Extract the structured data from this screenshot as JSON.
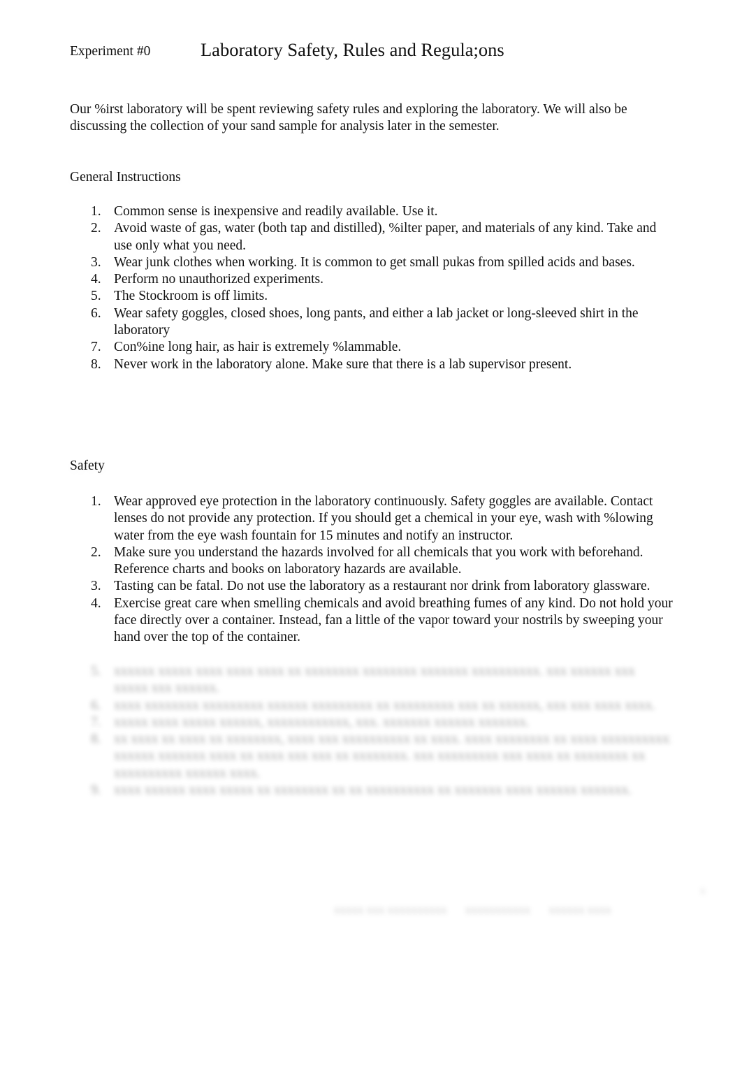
{
  "header": {
    "experiment_label": "Experiment #0",
    "title": "Laboratory Safety, Rules and Regula;ons"
  },
  "intro": "Our %irst laboratory will be spent reviewing safety rules and exploring the laboratory. We will also be discussing the collection of your sand sample for analysis later in the semester.",
  "general": {
    "heading": "General Instructions",
    "items": [
      {
        "num": "1.",
        "text": "Common sense is inexpensive and readily available. Use it."
      },
      {
        "num": "2.",
        "text": "Avoid waste of gas, water (both tap and distilled), %ilter paper, and materials of any kind. Take and use only what you need."
      },
      {
        "num": "3.",
        "text": "Wear junk clothes when working. It is common to get small pukas from spilled acids and bases."
      },
      {
        "num": "4.",
        "text": "Perform no unauthorized experiments."
      },
      {
        "num": "5.",
        "text": "The Stockroom is off limits."
      },
      {
        "num": "6.",
        "text": "Wear safety goggles, closed shoes, long pants, and either a lab jacket or long-sleeved shirt in the laboratory"
      },
      {
        "num": "7.",
        "text": "Con%ine long hair, as hair is extremely %lammable."
      },
      {
        "num": "8.",
        "text": "Never work in the laboratory alone. Make sure that there is a lab supervisor present."
      }
    ]
  },
  "safety": {
    "heading": "Safety",
    "items": [
      {
        "num": "1.",
        "text": "Wear approved eye protection in the laboratory continuously. Safety goggles are available. Contact lenses do not provide any protection. If you should get a chemical in your eye, wash with %lowing water from the eye wash fountain for 15 minutes and notify an instructor."
      },
      {
        "num": "2.",
        "text": "Make sure you understand the hazards involved for all chemicals that you work with beforehand. Reference charts and books on laboratory hazards are available."
      },
      {
        "num": "3.",
        "text": "Tasting can be fatal. Do not use the laboratory as a restaurant nor drink from laboratory glassware."
      },
      {
        "num": "4.",
        "text": "Exercise great care when smelling chemicals and avoid breathing fumes of any kind. Do not hold your face directly over a container. Instead, fan a little of the vapor toward your nostrils by sweeping your hand over the top of the container."
      }
    ],
    "blurred_rows": [
      {
        "num": "5.",
        "text": "xxxxxx xxxxx xxxx xxxx xxxx xx xxxxxxxx xxxxxxxx xxxxxxx xxxxxxxxxx. xxx xxxxxx xxx"
      },
      {
        "num": "",
        "text": "xxxxx xxx xxxxxx."
      },
      {
        "num": "6.",
        "text": "xxxx xxxxxxxx xxxxxxxxx xxxxxx xxxxxxxxx xx xxxxxxxxx xxx xx xxxxxx, xxx xxx xxxx xxxx."
      },
      {
        "num": "7.",
        "text": "xxxxx xxxx xxxxx xxxxxx, xxxxxxxxxxxx, xxx. xxxxxxx xxxxxx xxxxxxx."
      },
      {
        "num": "8.",
        "text": "xx xxxx xx xxxx xx xxxxxxxx, xxxx xxx xxxxxxxxxx xx xxxx. xxxx xxxxxxxx xx xxxx xxxxxxxxxxxxx xxx"
      },
      {
        "num": "",
        "text": "xxxxxx xxxxxxx xxxx xx xxxx xxx xxx xx xxxxxxxx. xxx xxxxxxxxx xxx xxxx xx xxxxxxxx xx"
      },
      {
        "num": "",
        "text": "xxxxxxxxxx xxxxxx xxxx."
      },
      {
        "num": "9.",
        "text": "xxxx xxxxxx xxxx xxxxx xx xxxxxxxx xx xx xxxxxxxxxx xx xxxxxxx xxxx xxxxxx xxxxxxx."
      }
    ]
  },
  "footer": {
    "items": [
      "xxxxx xxx xxxxxxxxxx",
      "xxxxxxxxxxx",
      "xxxxxx xxxx"
    ],
    "page_number": "x"
  }
}
